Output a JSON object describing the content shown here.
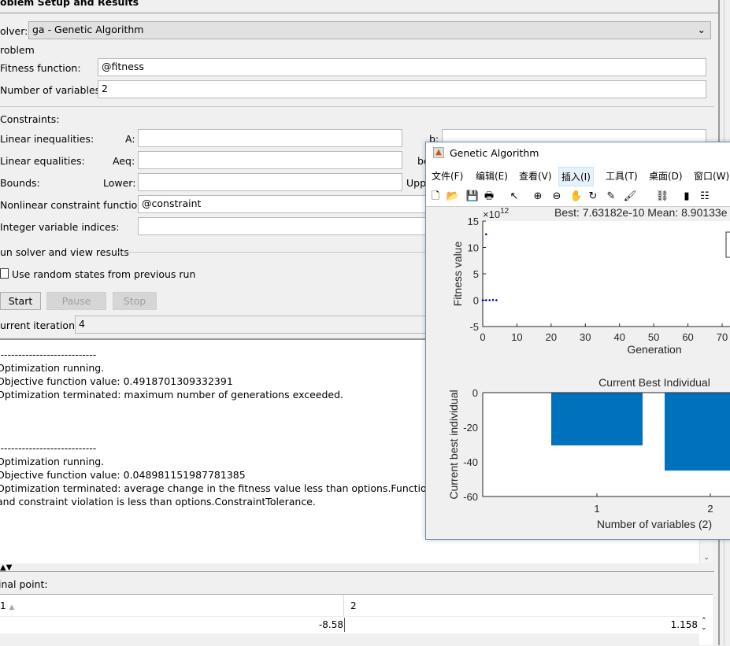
{
  "panel": {
    "title": "oblem Setup and Results",
    "solver_label": "olver:",
    "solver_value": "ga - Genetic Algorithm",
    "problem_label": "roblem",
    "fitness_label": "Fitness function:",
    "fitness_value": "@fitness",
    "nvars_label": "Number of variables:",
    "nvars_value": "2",
    "constraints_label": "Constraints:",
    "lin_ineq_label": "Linear inequalities:",
    "A_label": "A:",
    "b_label": "b:",
    "lin_eq_label": "Linear equalities:",
    "Aeq_label": "Aeq:",
    "beq_label": "be",
    "bounds_label": "Bounds:",
    "lower_label": "Lower:",
    "upper_label": "Upp",
    "nonlcon_label": "Nonlinear constraint function:",
    "nonlcon_value": "@constraint",
    "intcon_label": "Integer variable indices:",
    "run_label": "un solver and view results",
    "random_states_label": "Use random states from previous run",
    "start": "Start",
    "pause": "Pause",
    "stop": "Stop",
    "iter_label": "urrent iteration:",
    "iter_value": "4"
  },
  "output": [
    "----------------------------",
    "Optimization running.",
    "Objective function value: 0.4918701309332391",
    "Optimization terminated: maximum number of generations exceeded.",
    "",
    "",
    "",
    "----------------------------",
    "Optimization running.",
    "Objective function value: 0.048981151987781385",
    "Optimization terminated: average change in the fitness value less than options.FunctionTolerance",
    "and constraint violation is less than options.ConstraintTolerance."
  ],
  "final": {
    "label": "inal point:",
    "col1": "1",
    "col2": "2",
    "v1": "-8.58",
    "v2": "1.158"
  },
  "figure": {
    "title": "Genetic Algorithm",
    "menu": [
      "文件(F)",
      "编辑(E)",
      "查看(V)",
      "插入(I)",
      "工具(T)",
      "桌面(D)",
      "窗口(W)"
    ],
    "toolbar": [
      "new-icon",
      "open-icon",
      "save-icon",
      "print-icon",
      "pointer-icon",
      "zoom-in-icon",
      "zoom-out-icon",
      "pan-icon",
      "rotate-icon",
      "data-cursor-icon",
      "brush-icon",
      "link-icon",
      "colorbar-icon",
      "legend-icon"
    ]
  },
  "chart_data": [
    {
      "type": "scatter",
      "title": "Best: 7.63182e-10 Mean: 8.90133e",
      "xlabel": "Generation",
      "ylabel": "Fitness value",
      "exponent": "×10",
      "exponent_power": "12",
      "xlim": [
        0,
        70
      ],
      "ylim": [
        -5,
        15
      ],
      "xticks": [
        0,
        10,
        20,
        30,
        40,
        50,
        60,
        70
      ],
      "yticks": [
        -5,
        0,
        5,
        10,
        15
      ],
      "points": [
        {
          "x": 0,
          "y": 0
        },
        {
          "x": 1,
          "y": 12.5
        },
        {
          "x": 1,
          "y": 0
        },
        {
          "x": 2,
          "y": 0
        },
        {
          "x": 3,
          "y": 0.05
        },
        {
          "x": 4,
          "y": 0
        }
      ],
      "color": "#0000a0"
    },
    {
      "type": "bar",
      "title": "Current Best Individual",
      "xlabel": "Number of variables (2)",
      "ylabel": "Current best individual",
      "categories": [
        1,
        2
      ],
      "values": [
        -30.5,
        -45
      ],
      "ylim": [
        -60,
        0
      ],
      "yticks": [
        0,
        -20,
        -40,
        -60
      ],
      "color": "#0072bd"
    }
  ]
}
